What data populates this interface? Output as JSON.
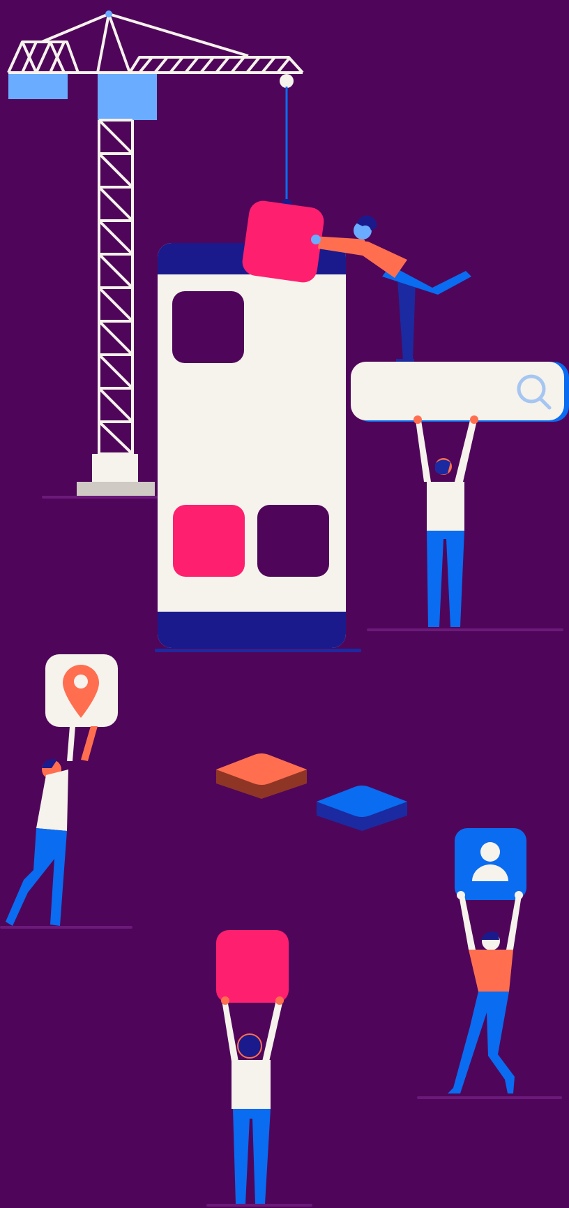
{
  "scene": {
    "background": "#4f065a",
    "palette": {
      "white": "#f6f2ec",
      "navy": "#1a1a8c",
      "pink": "#ff1f6f",
      "coral": "#ff6f4f",
      "blue": "#0a6cf0",
      "light_blue": "#6aacff",
      "dark_plum": "#4f065a",
      "shadow_line": "#6b1a7a",
      "rust": "#8f3526",
      "deep_blue": "#1b2aa0"
    },
    "items": [
      {
        "name": "construction-crane",
        "icon": "crane-icon"
      },
      {
        "name": "phone-mockup",
        "icon": "phone-icon"
      },
      {
        "name": "search-bar",
        "icon": "search-icon"
      },
      {
        "name": "location-card",
        "icon": "map-pin-icon"
      },
      {
        "name": "user-profile-card",
        "icon": "user-icon"
      },
      {
        "name": "floating-tiles",
        "icon": "tile-icon"
      },
      {
        "name": "pink-app-tile",
        "icon": "app-tile-icon"
      }
    ]
  }
}
